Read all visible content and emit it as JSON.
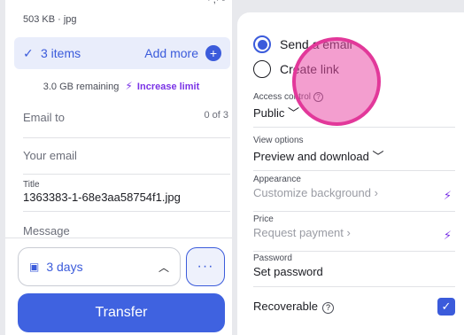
{
  "file": {
    "meta": "503 KB · jpg",
    "cut_text": "· ,· -"
  },
  "items_bar": {
    "label": "3 items",
    "add_more": "Add more",
    "check_icon": "check-icon",
    "plus_icon": "plus-circle-icon"
  },
  "storage": {
    "remaining": "3.0 GB remaining",
    "increase": "Increase limit"
  },
  "form": {
    "email_to_placeholder": "Email to",
    "email_to_count": "0 of 3",
    "your_email_placeholder": "Your email",
    "title_label": "Title",
    "title_value": "1363383-1-68e3aa58754f1.jpg",
    "message_placeholder": "Message"
  },
  "bottom": {
    "expiry": "3 days",
    "more": "···",
    "transfer": "Transfer"
  },
  "share_mode": {
    "send_email": "Send a email",
    "create_link": "Create link",
    "selected": "send_email"
  },
  "options": {
    "access_control_label": "Access control",
    "access_control_value": "Public",
    "view_options_label": "View options",
    "view_options_value": "Preview and download",
    "appearance_label": "Appearance",
    "appearance_value": "Customize background",
    "price_label": "Price",
    "price_value": "Request payment",
    "password_label": "Password",
    "password_value": "Set password",
    "recoverable_label": "Recoverable",
    "recoverable_checked": true
  },
  "colors": {
    "accent": "#3b5bdb",
    "premium": "#7a33e6",
    "highlight": "#e2389a"
  }
}
